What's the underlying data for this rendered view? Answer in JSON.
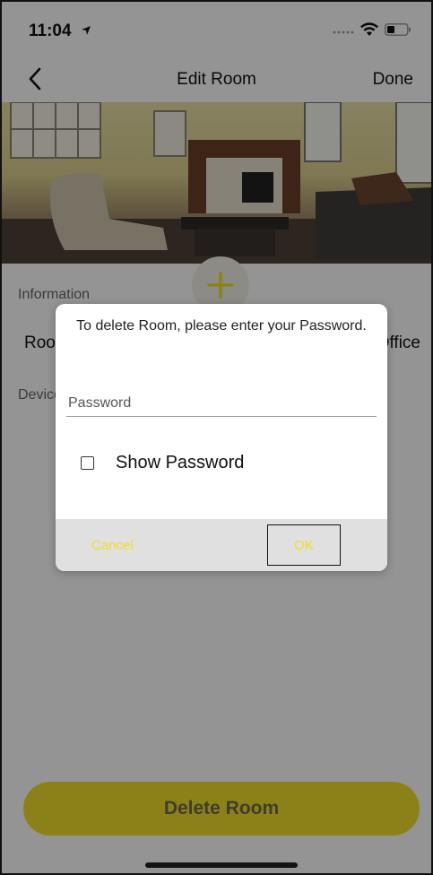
{
  "status_bar": {
    "time": "11:04"
  },
  "nav": {
    "title": "Edit Room",
    "done_label": "Done"
  },
  "information": {
    "header": "Information",
    "room_label": "Room",
    "room_value": "Office"
  },
  "devices": {
    "header": "Devices"
  },
  "delete_button_label": "Delete Room",
  "dialog": {
    "message": "To delete Room, please enter your Password.",
    "password_placeholder": "Password",
    "password_value": "",
    "show_password_label": "Show Password",
    "show_password_checked": false,
    "cancel_label": "Cancel",
    "ok_label": "OK"
  },
  "colors": {
    "accent_yellow": "#f2de2a",
    "dialog_button_bar": "#e0e0e0"
  },
  "icons": {
    "back": "chevron-left-icon",
    "add": "plus-icon",
    "location": "location-arrow-icon",
    "wifi": "wifi-icon",
    "battery": "battery-icon"
  }
}
